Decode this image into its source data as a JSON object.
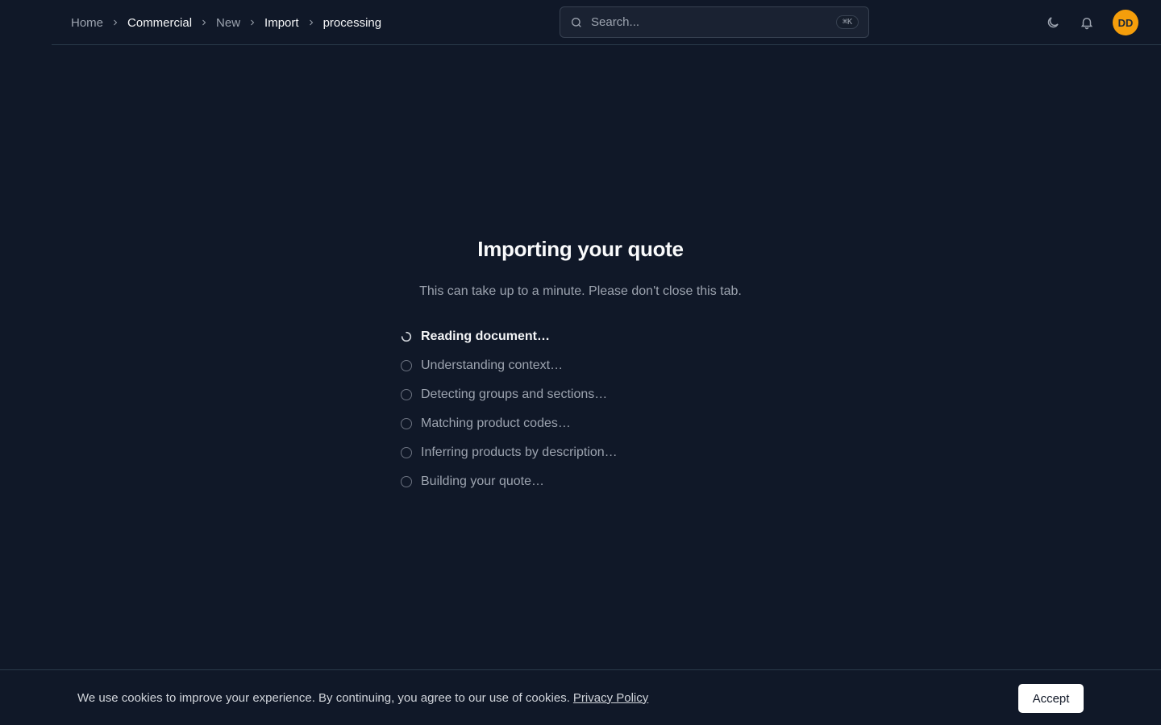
{
  "breadcrumb": [
    {
      "label": "Home"
    },
    {
      "label": "Commercial"
    },
    {
      "label": "New"
    },
    {
      "label": "Import"
    },
    {
      "label": "processing"
    }
  ],
  "search": {
    "placeholder": "Search...",
    "shortcut": "⌘K"
  },
  "user": {
    "initials": "DD",
    "avatar_color": "#f59e0b"
  },
  "main": {
    "title": "Importing your quote",
    "subtitle": "This can take up to a minute. Please don't close this tab.",
    "steps": [
      {
        "label": "Reading document…",
        "status": "in-progress"
      },
      {
        "label": "Understanding context…",
        "status": "pending"
      },
      {
        "label": "Detecting groups and sections…",
        "status": "pending"
      },
      {
        "label": "Matching product codes…",
        "status": "pending"
      },
      {
        "label": "Inferring products by description…",
        "status": "pending"
      },
      {
        "label": "Building your quote…",
        "status": "pending"
      }
    ]
  },
  "cookie": {
    "text": "We use cookies to improve your experience. By continuing, you agree to our use of cookies.",
    "link": "Privacy Policy",
    "accept": "Accept"
  },
  "colors": {
    "background": "#101828",
    "accent": "#f59e0b",
    "border": "#2a3a4a"
  },
  "icons": [
    "chevron-right-icon",
    "search-icon",
    "moon-icon",
    "bell-icon",
    "spinner-icon",
    "circle-icon"
  ]
}
